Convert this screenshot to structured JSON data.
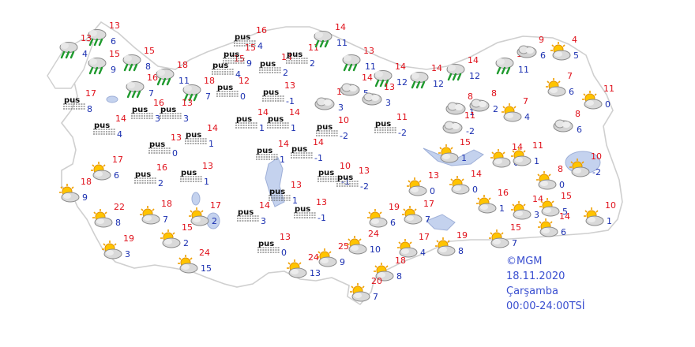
{
  "map_info": {
    "copyright": "©MGM",
    "date": "18.11.2020",
    "day": "Çarşamba",
    "hours": "00:00-24:00TSİ"
  },
  "colors": {
    "land": "#ffffff",
    "border": "#c9c9c9",
    "water": "#c4d2ee",
    "high_temp": "#e0101a",
    "low_temp": "#1a2fb0",
    "legend": "#3a4fd0"
  },
  "fog_label": "pus",
  "icon_types": {
    "rain": "rain-cloud-icon",
    "fog": "fog-icon",
    "pc": "partly-cloudy-icon",
    "cloud": "cloudy-icon"
  },
  "stations": [
    {
      "icon": "rain",
      "hi": "13",
      "lo": "6"
    },
    {
      "icon": "rain",
      "hi": "13",
      "lo": "4"
    },
    {
      "icon": "rain",
      "hi": "15",
      "lo": "9"
    },
    {
      "icon": "rain",
      "hi": "15",
      "lo": "8"
    },
    {
      "icon": "rain",
      "hi": "16",
      "lo": "7"
    },
    {
      "icon": "rain",
      "hi": "18",
      "lo": "11"
    },
    {
      "icon": "rain",
      "hi": "18",
      "lo": "7"
    },
    {
      "icon": "fog",
      "hi": "17",
      "lo": "8"
    },
    {
      "icon": "fog",
      "hi": "16",
      "lo": "3"
    },
    {
      "icon": "fog",
      "hi": "13",
      "lo": "3"
    },
    {
      "icon": "fog",
      "hi": "14",
      "lo": "4"
    },
    {
      "icon": "fog",
      "hi": "15",
      "lo": "4"
    },
    {
      "icon": "fog",
      "hi": "15",
      "lo": "9"
    },
    {
      "icon": "fog",
      "hi": "16",
      "lo": "4"
    },
    {
      "icon": "fog",
      "hi": "14",
      "lo": "2"
    },
    {
      "icon": "fog",
      "hi": "11",
      "lo": "2"
    },
    {
      "icon": "fog",
      "hi": "12",
      "lo": "0"
    },
    {
      "icon": "fog",
      "hi": "13",
      "lo": "-1"
    },
    {
      "icon": "fog",
      "hi": "14",
      "lo": "1"
    },
    {
      "icon": "fog",
      "hi": "13",
      "lo": "0"
    },
    {
      "icon": "fog",
      "hi": "14",
      "lo": "1"
    },
    {
      "icon": "fog",
      "hi": "14",
      "lo": "1"
    },
    {
      "icon": "fog",
      "hi": "14",
      "lo": "1"
    },
    {
      "icon": "fog",
      "hi": "10",
      "lo": "-2"
    },
    {
      "icon": "fog",
      "hi": "11",
      "lo": "-2"
    },
    {
      "icon": "fog",
      "hi": "14",
      "lo": "-1"
    },
    {
      "icon": "fog",
      "hi": "16",
      "lo": "2"
    },
    {
      "icon": "fog",
      "hi": "13",
      "lo": "1"
    },
    {
      "icon": "fog",
      "hi": "10",
      "lo": "-1"
    },
    {
      "icon": "fog",
      "hi": "13",
      "lo": "-2"
    },
    {
      "icon": "fog",
      "hi": "13",
      "lo": "1"
    },
    {
      "icon": "fog",
      "hi": "14",
      "lo": "3"
    },
    {
      "icon": "fog",
      "hi": "13",
      "lo": "-1"
    },
    {
      "icon": "fog",
      "hi": "13",
      "lo": "0"
    },
    {
      "icon": "rain",
      "hi": "14",
      "lo": "11"
    },
    {
      "icon": "rain",
      "hi": "13",
      "lo": "11"
    },
    {
      "icon": "rain",
      "hi": "14",
      "lo": "12"
    },
    {
      "icon": "rain",
      "hi": "14",
      "lo": "12"
    },
    {
      "icon": "rain",
      "hi": "14",
      "lo": "12"
    },
    {
      "icon": "rain",
      "hi": "14",
      "lo": "11"
    },
    {
      "icon": "cloud",
      "hi": "13",
      "lo": "3"
    },
    {
      "icon": "cloud",
      "hi": "14",
      "lo": "5"
    },
    {
      "icon": "cloud",
      "hi": "13",
      "lo": "3"
    },
    {
      "icon": "cloud",
      "hi": "8",
      "lo": "1"
    },
    {
      "icon": "cloud",
      "hi": "8",
      "lo": "2"
    },
    {
      "icon": "cloud",
      "hi": "9",
      "lo": "6"
    },
    {
      "icon": "pc",
      "hi": "4",
      "lo": "5"
    },
    {
      "icon": "pc",
      "hi": "7",
      "lo": "6"
    },
    {
      "icon": "pc",
      "hi": "11",
      "lo": "0"
    },
    {
      "icon": "pc",
      "hi": "7",
      "lo": "4"
    },
    {
      "icon": "cloud",
      "hi": "8",
      "lo": "6"
    },
    {
      "icon": "cloud",
      "hi": "11",
      "lo": "-2"
    },
    {
      "icon": "pc",
      "hi": "15",
      "lo": "1"
    },
    {
      "icon": "pc",
      "hi": "14",
      "lo": "0"
    },
    {
      "icon": "pc",
      "hi": "11",
      "lo": "1"
    },
    {
      "icon": "pc",
      "hi": "10",
      "lo": "-2"
    },
    {
      "icon": "pc",
      "hi": "13",
      "lo": "0"
    },
    {
      "icon": "pc",
      "hi": "14",
      "lo": "0"
    },
    {
      "icon": "pc",
      "hi": "8",
      "lo": "0"
    },
    {
      "icon": "pc",
      "hi": "16",
      "lo": "1"
    },
    {
      "icon": "pc",
      "hi": "14",
      "lo": "3"
    },
    {
      "icon": "pc",
      "hi": "15",
      "lo": "5"
    },
    {
      "icon": "pc",
      "hi": "10",
      "lo": "1"
    },
    {
      "icon": "pc",
      "hi": "14",
      "lo": "6"
    },
    {
      "icon": "pc",
      "hi": "17",
      "lo": "6"
    },
    {
      "icon": "pc",
      "hi": "18",
      "lo": "9"
    },
    {
      "icon": "pc",
      "hi": "22",
      "lo": "8"
    },
    {
      "icon": "pc",
      "hi": "18",
      "lo": "7"
    },
    {
      "icon": "pc",
      "hi": "17",
      "lo": "2"
    },
    {
      "icon": "pc",
      "hi": "15",
      "lo": "2"
    },
    {
      "icon": "pc",
      "hi": "19",
      "lo": "3"
    },
    {
      "icon": "pc",
      "hi": "24",
      "lo": "15"
    },
    {
      "icon": "pc",
      "hi": "19",
      "lo": "6"
    },
    {
      "icon": "pc",
      "hi": "17",
      "lo": "7"
    },
    {
      "icon": "pc",
      "hi": "24",
      "lo": "10"
    },
    {
      "icon": "pc",
      "hi": "17",
      "lo": "4"
    },
    {
      "icon": "pc",
      "hi": "25",
      "lo": "9"
    },
    {
      "icon": "pc",
      "hi": "24",
      "lo": "13"
    },
    {
      "icon": "pc",
      "hi": "18",
      "lo": "8"
    },
    {
      "icon": "pc",
      "hi": "20",
      "lo": "7"
    },
    {
      "icon": "pc",
      "hi": "19",
      "lo": "8"
    },
    {
      "icon": "pc",
      "hi": "15",
      "lo": "7"
    }
  ]
}
